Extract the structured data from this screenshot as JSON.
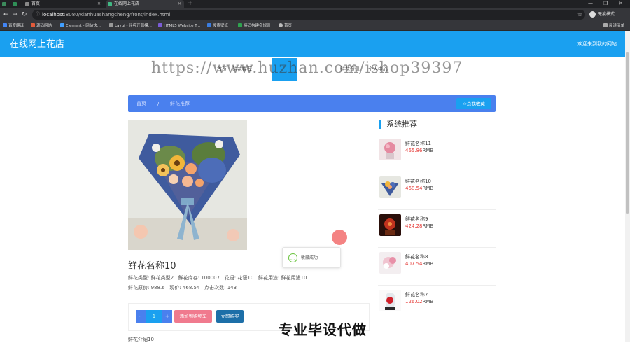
{
  "browser": {
    "tabs": [
      {
        "title": "",
        "active": false
      },
      {
        "title": "",
        "active": false
      },
      {
        "title": "首页",
        "active": false
      },
      {
        "title": "在线网上花店",
        "active": true
      }
    ],
    "url_host": "localhost",
    "url_rest": ":8080/xianhuashangcheng/front/index.html",
    "profile_label": "无痕模式",
    "bookmarks": [
      "百度翻译",
      "源码网站",
      "Element - 网站快...",
      "Layui - 经典开源模...",
      "HTML5 Website T...",
      "搜索壁纸",
      "接码构建名规则",
      "首页"
    ],
    "bookmarks_right": "阅读清单",
    "accent": "#1aa0f0"
  },
  "header": {
    "site_title": "在线网上花店",
    "welcome": "欢迎来到我的网站"
  },
  "nav": {
    "items": [
      "首页",
      "鲜花推荐",
      "",
      "",
      "鲜花资讯",
      "个人中心"
    ]
  },
  "watermark": {
    "top": "https://www.huzhan.com/ishop39397",
    "bottom": "专业毕设代做"
  },
  "breadcrumb": {
    "home": "首页",
    "separator": "/",
    "current": "鲜花推荐",
    "favorite_button": "☆点我收藏"
  },
  "product": {
    "name": "鲜花名称10",
    "type_label": "鲜花类型:",
    "type_value": "鲜花类型2",
    "stock_label": "鲜花库存:",
    "stock_value": "100007",
    "language_label": "花语:",
    "language_value": "花语10",
    "use_label": "鲜花用途:",
    "use_value": "鲜花用途10",
    "original_price_label": "鲜花原价:",
    "original_price_value": "988.6",
    "current_price_label": "现价:",
    "current_price_value": "468.54",
    "clicks_label": "点击次数:",
    "clicks_value": "143",
    "quantity": "1",
    "minus": "-",
    "plus": "+",
    "add_to_cart": "添加到购物车",
    "buy_now": "立即购买",
    "intro_label": "鲜花介绍10"
  },
  "toast": {
    "text": "收藏成功",
    "icon": "smile-icon"
  },
  "recommend": {
    "title": "系统推荐",
    "currency": "RMB",
    "items": [
      {
        "name": "鲜花名称11",
        "price": "465.86"
      },
      {
        "name": "鲜花名称10",
        "price": "468.54"
      },
      {
        "name": "鲜花名称9",
        "price": "424.28"
      },
      {
        "name": "鲜花名称8",
        "price": "407.54"
      },
      {
        "name": "鲜花名称7",
        "price": "126.02"
      }
    ]
  }
}
